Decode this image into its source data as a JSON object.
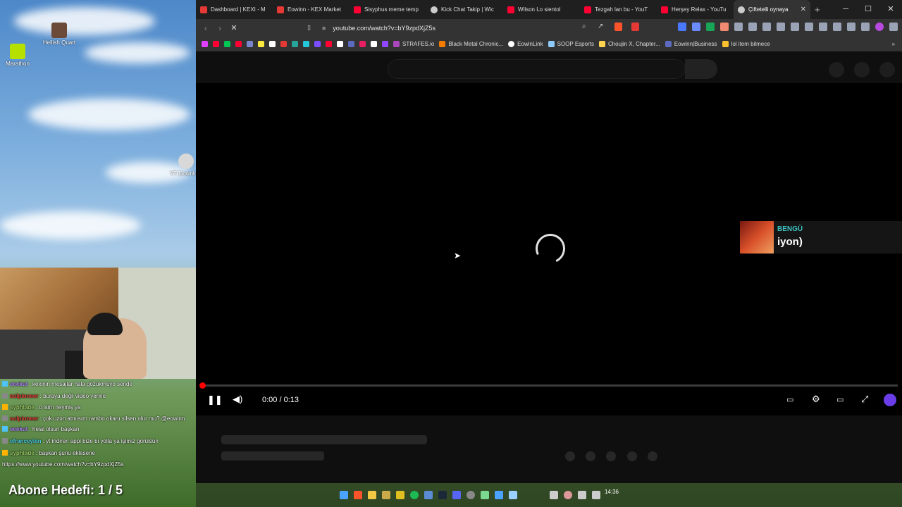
{
  "desktop": {
    "icons": [
      {
        "label": "Hellish Quart"
      },
      {
        "label": "Marathon"
      },
      {
        "label": "YT Downlo..."
      }
    ]
  },
  "browser": {
    "tabs": [
      {
        "label": "Dashboard | KEXI - M",
        "color": "#e53935"
      },
      {
        "label": "Eowinn - KEX Market",
        "color": "#e53935"
      },
      {
        "label": "Sisyphus meme temp",
        "color": "#ff0033"
      },
      {
        "label": "Kick Chat Takip | Wic",
        "color": "#cccccc"
      },
      {
        "label": "Wilson Lo sientol",
        "color": "#ff0033"
      },
      {
        "label": "Tezgah lan bu - YouT",
        "color": "#ff0033"
      },
      {
        "label": "Herşey Relax - YouTu",
        "color": "#ff0033"
      },
      {
        "label": "Çiftetelli oynaya",
        "color": "#cccccc"
      }
    ],
    "new_tab": "+",
    "close_tab": "✕",
    "url": "youtube.com/watch?v=bY9zpdXjZ5s",
    "bookmarks": [
      {
        "label": "",
        "color": "#e040fb"
      },
      {
        "label": "",
        "color": "#ff0033"
      },
      {
        "label": "",
        "color": "#00c853"
      },
      {
        "label": "",
        "color": "#ff0033"
      },
      {
        "label": "",
        "color": "#7986cb"
      },
      {
        "label": "",
        "color": "#ffeb3b"
      },
      {
        "label": "",
        "color": "#ffffff"
      },
      {
        "label": "",
        "color": "#e53935"
      },
      {
        "label": "",
        "color": "#26a69a"
      },
      {
        "label": "",
        "color": "#26c6da"
      },
      {
        "label": "",
        "color": "#7c4dff"
      },
      {
        "label": "",
        "color": "#ff0033"
      },
      {
        "label": "",
        "color": "#ffffff"
      },
      {
        "label": "",
        "color": "#5c6bc0"
      },
      {
        "label": "",
        "color": "#e91e63"
      },
      {
        "label": "",
        "color": "#ffffff"
      },
      {
        "label": "",
        "color": "#9146ff"
      },
      {
        "label": "STRAFES.io",
        "color": "#ab47bc"
      },
      {
        "label": "Black Metal Chronic...",
        "color": "#f57c00"
      },
      {
        "label": "EowinLink",
        "color": "#ffffff"
      },
      {
        "label": "SOOP Esports",
        "color": "#90caf9"
      },
      {
        "label": "Choujin X, Chapter...",
        "color": "#ffd54f"
      },
      {
        "label": "Eowinn|Business",
        "color": "#5c6bc0"
      },
      {
        "label": "lol item bilmece",
        "color": "#fbc02d"
      }
    ]
  },
  "player": {
    "time": "0:00 / 0:13",
    "progress_fraction": 0.0,
    "card": {
      "artist": "BENGÜ",
      "title": "iyon)"
    }
  },
  "chat": {
    "messages": [
      {
        "user": "eeekut",
        "text": "kexinin mesajlar hala gözükmüyo sende",
        "color": "#b388ff"
      },
      {
        "user": "solpioneer",
        "text": "buraya değil video yerine",
        "color": "#e53935"
      },
      {
        "user": "syphlade",
        "text": "o isim neymiş ya",
        "color": "#9ccc65"
      },
      {
        "user": "solpioneer",
        "text": "çok uzun atmısım rambo okanı silsen olur mu? @eowinn",
        "color": "#e53935"
      },
      {
        "user": "eeekut",
        "text": "helal olsun başkan",
        "color": "#b388ff"
      },
      {
        "user": "efranceylan",
        "text": "yt indiren appi bize bi yolla ya işimiz görülsün",
        "color": "#4dd0e1"
      },
      {
        "user": "syphlade",
        "text": "başkan şunu eklesene",
        "color": "#9ccc65"
      }
    ],
    "last_line": "https://www.youtube.com/watch?v=bY9zpdXjZ5s",
    "goal": "Abone Hedefi:  1 / 5"
  },
  "taskbar": {
    "clock": "14:36"
  }
}
